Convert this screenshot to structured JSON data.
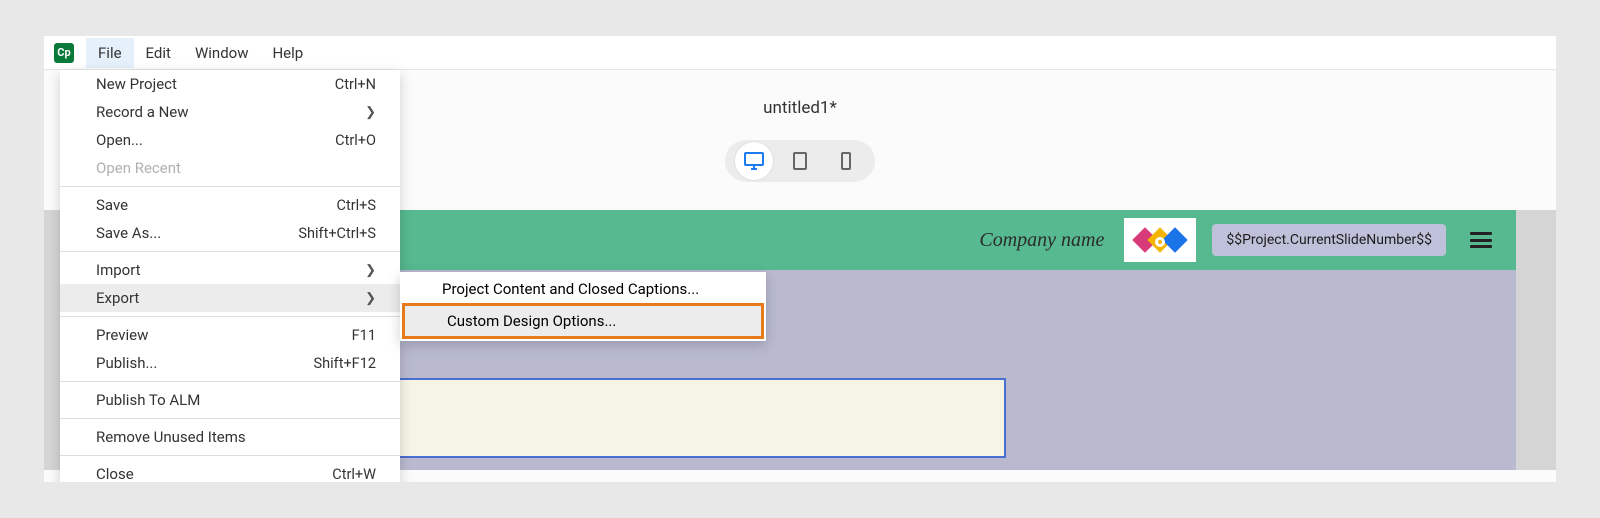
{
  "menubar": {
    "items": [
      "File",
      "Edit",
      "Window",
      "Help"
    ],
    "active_index": 0
  },
  "document": {
    "title": "untitled1*"
  },
  "devices": {
    "active": "desktop"
  },
  "slide": {
    "company_label": "Company name",
    "variable_text": "$$Project.CurrentSlideNumber$$"
  },
  "file_menu": {
    "groups": [
      [
        {
          "label": "New Project",
          "shortcut": "Ctrl+N"
        },
        {
          "label": "Record a New",
          "submenu": true
        },
        {
          "label": "Open...",
          "shortcut": "Ctrl+O"
        },
        {
          "label": "Open Recent",
          "disabled": true
        }
      ],
      [
        {
          "label": "Save",
          "shortcut": "Ctrl+S"
        },
        {
          "label": "Save As...",
          "shortcut": "Shift+Ctrl+S"
        }
      ],
      [
        {
          "label": "Import",
          "submenu": true
        },
        {
          "label": "Export",
          "submenu": true,
          "hover": true
        }
      ],
      [
        {
          "label": "Preview",
          "shortcut": "F11"
        },
        {
          "label": "Publish...",
          "shortcut": "Shift+F12"
        }
      ],
      [
        {
          "label": "Publish To ALM"
        }
      ],
      [
        {
          "label": "Remove Unused Items"
        }
      ],
      [
        {
          "label": "Close",
          "shortcut": "Ctrl+W"
        }
      ]
    ]
  },
  "export_submenu": {
    "items": [
      {
        "label": "Project Content and Closed Captions..."
      },
      {
        "label": "Custom Design Options...",
        "highlight": true
      }
    ]
  }
}
